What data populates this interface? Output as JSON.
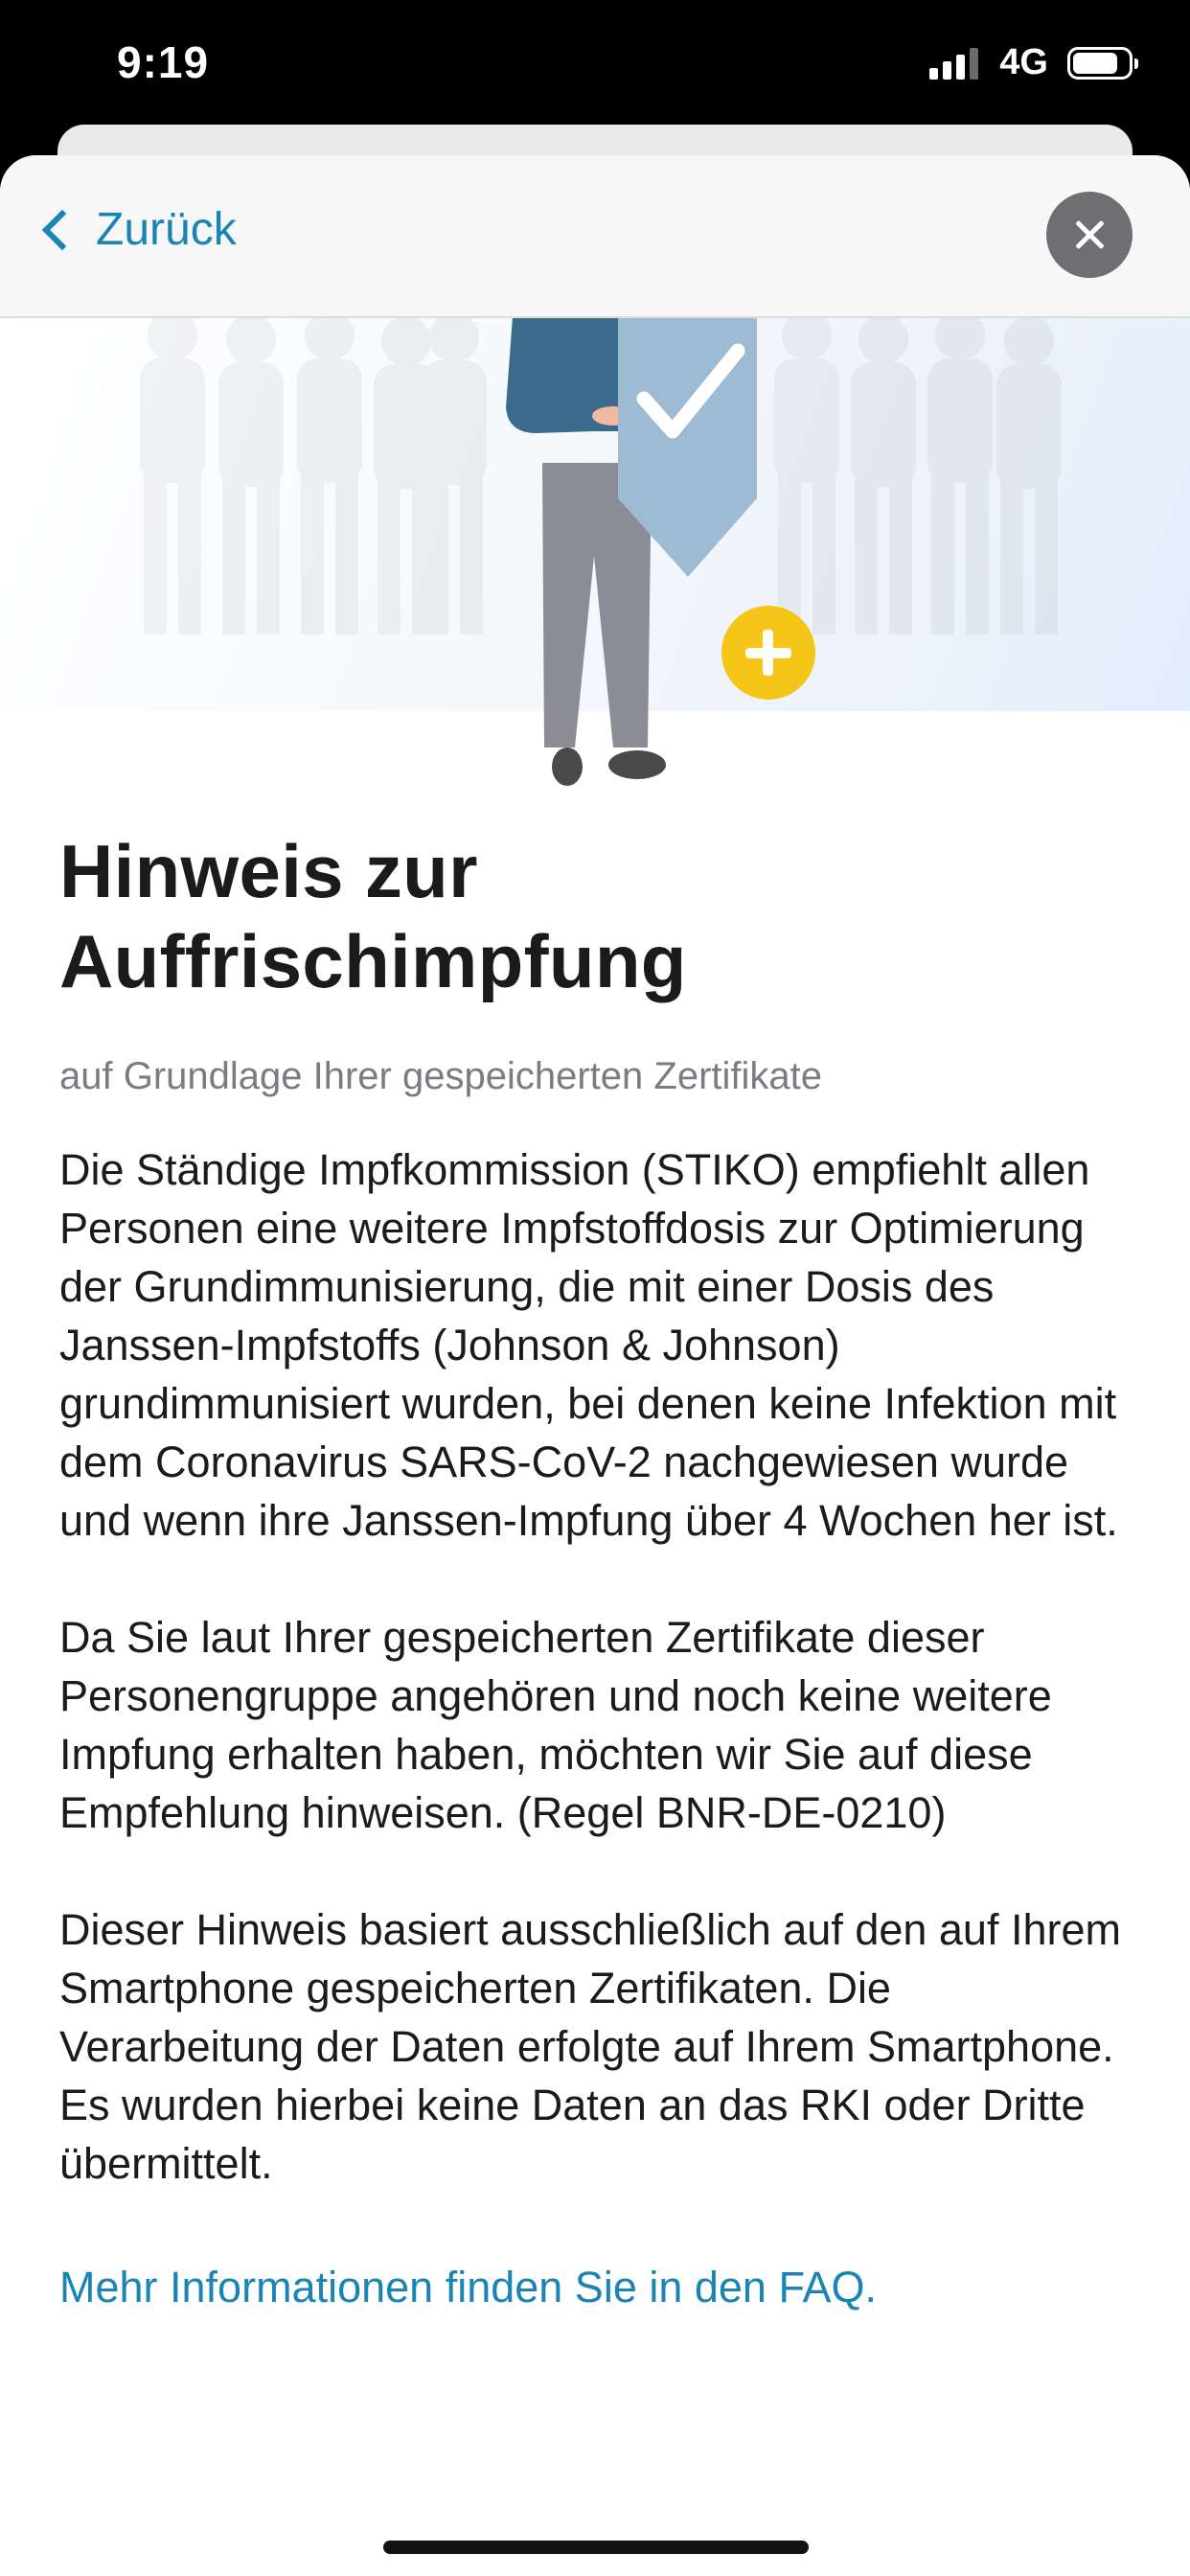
{
  "status_bar": {
    "time": "9:19",
    "network": "4G"
  },
  "nav": {
    "back_label": "Zurück"
  },
  "content": {
    "title": "Hinweis zur\nAuffrischimpfung",
    "subtitle": "auf Grundlage Ihrer gespeicherten Zertifikate",
    "paragraph_1": "Die Ständige Impfkommission (STIKO) empfiehlt allen Personen eine weitere Impfstoffdosis zur Optimierung der Grundimmunisierung, die mit einer Dosis des Janssen-Impfstoffs (Johnson & Johnson) grundimmunisiert wurden, bei denen keine Infektion mit dem Coronavirus SARS-CoV-2 nachgewiesen wurde und wenn ihre Janssen-Impfung über 4 Wochen her ist.",
    "paragraph_2": "Da Sie laut Ihrer gespeicherten Zertifikate dieser Personengruppe angehören und noch keine weitere Impfung erhalten haben, möchten wir Sie auf diese Empfehlung hinweisen. (Regel BNR-DE-0210)",
    "paragraph_3": "Dieser Hinweis basiert ausschließlich auf den auf Ihrem Smartphone gespeicherten Zertifikaten. Die Verarbeitung der Daten erfolgte auf Ihrem Smartphone. Es wurden hierbei keine Daten an das RKI oder Dritte übermittelt.",
    "faq_link": "Mehr Informationen finden Sie in den FAQ."
  },
  "colors": {
    "accent": "#1a85b4",
    "shield": "#9dbcd4",
    "plus_badge": "#f5c518",
    "jacket": "#3b6b8c",
    "trousers": "#8c8c96"
  },
  "icons": [
    "chevron-left-icon",
    "close-icon",
    "checkmark-icon",
    "plus-icon"
  ]
}
